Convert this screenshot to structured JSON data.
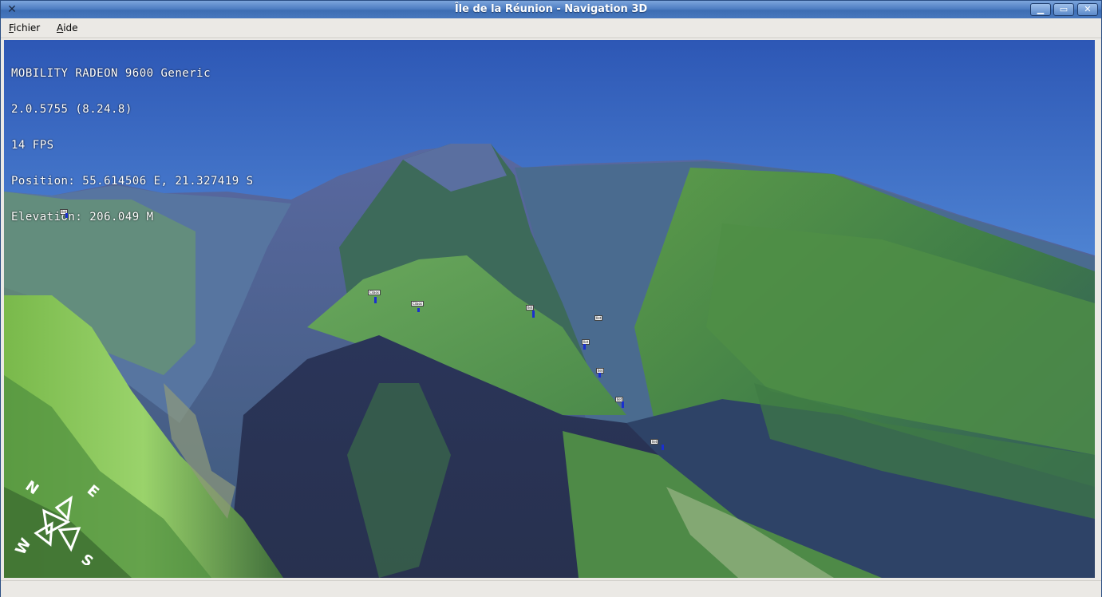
{
  "window": {
    "title": "Île de la Réunion - Navigation 3D",
    "buttons": [
      "minimize-icon",
      "maximize-icon",
      "close-icon"
    ]
  },
  "menu": {
    "file": "Fichier",
    "help": "Aide"
  },
  "hud": {
    "renderer": "MOBILITY RADEON 9600 Generic",
    "version": "2.0.5755 (8.24.8)",
    "fps": "14 FPS",
    "position": "Position: 55.614506 E, 21.327419 S",
    "elevation": "Elevation: 206.049 M"
  },
  "markers": [
    {
      "label": "Cilaos"
    },
    {
      "label": "Cilaos"
    },
    {
      "label": "Ilet"
    },
    {
      "label": "Ilet"
    },
    {
      "label": "Ilet"
    },
    {
      "label": "Ilet"
    },
    {
      "label": "Ilet"
    },
    {
      "label": "Ilet"
    },
    {
      "label": "Ilet"
    }
  ],
  "compass": {
    "north": "N",
    "east": "E",
    "south": "S",
    "west": "W"
  },
  "colors": {
    "sky_top": "#2d57b5",
    "sky_horizon": "#7eb7ef",
    "mountain_green": "#4f9a3e",
    "shadow_blue": "#2b3c6c",
    "marker_pole": "#1a2fd0"
  }
}
